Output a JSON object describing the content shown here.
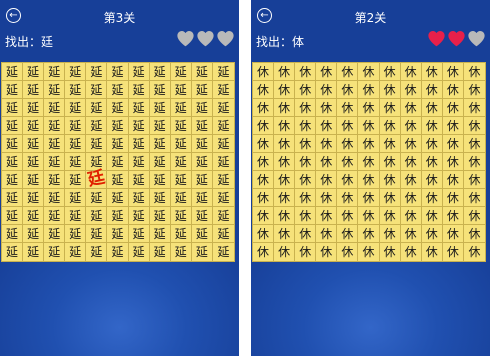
{
  "left": {
    "back_icon": "back-arrow-circle-icon",
    "title": "第3关",
    "find_label": "找出：廷",
    "hearts": [
      "empty",
      "empty",
      "empty"
    ],
    "grid": {
      "rows": 11,
      "cols": 11,
      "fill_char": "延",
      "found": [
        {
          "row": 6,
          "col": 4,
          "char": "廷"
        }
      ]
    }
  },
  "right": {
    "back_icon": "back-arrow-circle-icon",
    "title": "第2关",
    "find_label": "找出：体",
    "hearts": [
      "full",
      "full",
      "empty"
    ],
    "grid": {
      "rows": 11,
      "cols": 11,
      "fill_char": "休",
      "found": []
    }
  },
  "colors": {
    "heart_full": "#e8204a",
    "heart_empty": "#b9b9b9",
    "grid_bg": "#f6e27a",
    "highlight": "#e02000"
  }
}
